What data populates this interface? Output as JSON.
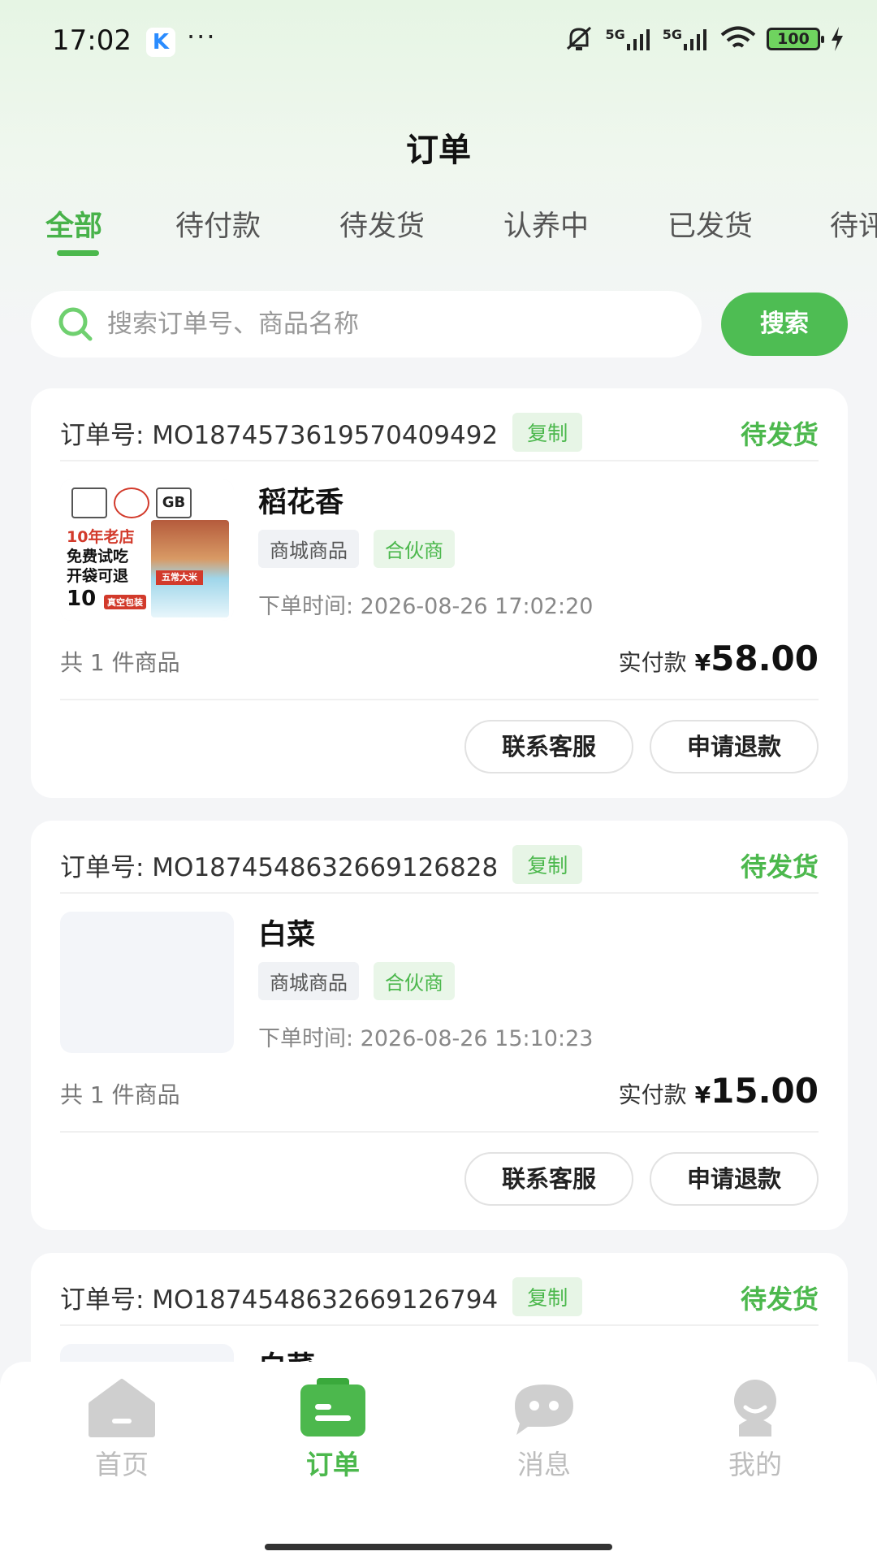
{
  "status_bar": {
    "time": "17:02",
    "app_icon_letter": "K",
    "more": "···",
    "signal_1": "5G",
    "signal_2": "5G",
    "battery": "100",
    "icons": [
      "mute-icon",
      "signal-icon",
      "wifi-icon",
      "battery-icon",
      "charging-icon"
    ]
  },
  "header": {
    "title": "订单"
  },
  "tabs": [
    {
      "label": "全部",
      "active": true
    },
    {
      "label": "待付款",
      "active": false
    },
    {
      "label": "待发货",
      "active": false
    },
    {
      "label": "认养中",
      "active": false
    },
    {
      "label": "已发货",
      "active": false
    },
    {
      "label": "待评",
      "active": false
    }
  ],
  "search": {
    "placeholder": "搜索订单号、商品名称",
    "value": "",
    "button_label": "搜索"
  },
  "orders": [
    {
      "order_no": "订单号: MO1874573619570409492",
      "copy_label": "复制",
      "status": "待发货",
      "product_name": "稻花香",
      "tags": [
        "商城商品",
        "合伙商"
      ],
      "order_time": "下单时间: 2026-08-26 17:02:20",
      "item_count": "共 1 件商品",
      "pay_label": "实付款",
      "currency": "¥",
      "amount": "58.00",
      "buttons": [
        "联系客服",
        "申请退款"
      ],
      "thumb_art": {
        "line1": "10年老店",
        "line2": "免费试吃",
        "line3": "开袋可退",
        "badge": "10",
        "seal": "真空包装",
        "logo_gb": "GB",
        "bag_label": "五常大米"
      }
    },
    {
      "order_no": "订单号: MO1874548632669126828",
      "copy_label": "复制",
      "status": "待发货",
      "product_name": "白菜",
      "tags": [
        "商城商品",
        "合伙商"
      ],
      "order_time": "下单时间: 2026-08-26 15:10:23",
      "item_count": "共 1 件商品",
      "pay_label": "实付款",
      "currency": "¥",
      "amount": "15.00",
      "buttons": [
        "联系客服",
        "申请退款"
      ]
    },
    {
      "order_no": "订单号: MO1874548632669126794",
      "copy_label": "复制",
      "status": "待发货",
      "product_name": "白菜"
    }
  ],
  "bottom_nav": [
    {
      "label": "首页",
      "icon": "home-icon",
      "active": false
    },
    {
      "label": "订单",
      "icon": "order-icon",
      "active": true
    },
    {
      "label": "消息",
      "icon": "message-icon",
      "active": false
    },
    {
      "label": "我的",
      "icon": "profile-icon",
      "active": false
    }
  ],
  "colors": {
    "accent": "#4cb84d",
    "background": "#f4f5f7",
    "inactive": "#bdbdbd"
  }
}
